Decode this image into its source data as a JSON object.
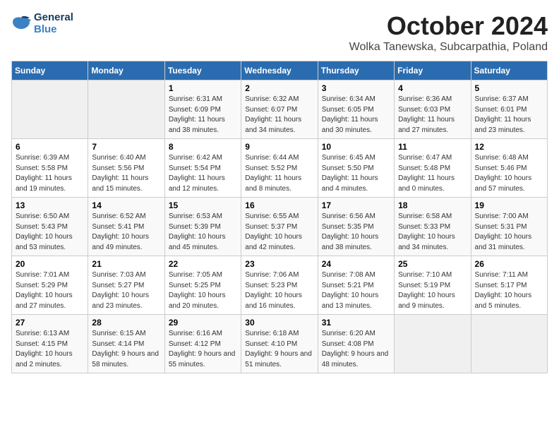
{
  "header": {
    "logo_line1": "General",
    "logo_line2": "Blue",
    "month_title": "October 2024",
    "subtitle": "Wolka Tanewska, Subcarpathia, Poland"
  },
  "weekdays": [
    "Sunday",
    "Monday",
    "Tuesday",
    "Wednesday",
    "Thursday",
    "Friday",
    "Saturday"
  ],
  "weeks": [
    [
      {
        "day": "",
        "info": ""
      },
      {
        "day": "",
        "info": ""
      },
      {
        "day": "1",
        "info": "Sunrise: 6:31 AM\nSunset: 6:09 PM\nDaylight: 11 hours and 38 minutes."
      },
      {
        "day": "2",
        "info": "Sunrise: 6:32 AM\nSunset: 6:07 PM\nDaylight: 11 hours and 34 minutes."
      },
      {
        "day": "3",
        "info": "Sunrise: 6:34 AM\nSunset: 6:05 PM\nDaylight: 11 hours and 30 minutes."
      },
      {
        "day": "4",
        "info": "Sunrise: 6:36 AM\nSunset: 6:03 PM\nDaylight: 11 hours and 27 minutes."
      },
      {
        "day": "5",
        "info": "Sunrise: 6:37 AM\nSunset: 6:01 PM\nDaylight: 11 hours and 23 minutes."
      }
    ],
    [
      {
        "day": "6",
        "info": "Sunrise: 6:39 AM\nSunset: 5:58 PM\nDaylight: 11 hours and 19 minutes."
      },
      {
        "day": "7",
        "info": "Sunrise: 6:40 AM\nSunset: 5:56 PM\nDaylight: 11 hours and 15 minutes."
      },
      {
        "day": "8",
        "info": "Sunrise: 6:42 AM\nSunset: 5:54 PM\nDaylight: 11 hours and 12 minutes."
      },
      {
        "day": "9",
        "info": "Sunrise: 6:44 AM\nSunset: 5:52 PM\nDaylight: 11 hours and 8 minutes."
      },
      {
        "day": "10",
        "info": "Sunrise: 6:45 AM\nSunset: 5:50 PM\nDaylight: 11 hours and 4 minutes."
      },
      {
        "day": "11",
        "info": "Sunrise: 6:47 AM\nSunset: 5:48 PM\nDaylight: 11 hours and 0 minutes."
      },
      {
        "day": "12",
        "info": "Sunrise: 6:48 AM\nSunset: 5:46 PM\nDaylight: 10 hours and 57 minutes."
      }
    ],
    [
      {
        "day": "13",
        "info": "Sunrise: 6:50 AM\nSunset: 5:43 PM\nDaylight: 10 hours and 53 minutes."
      },
      {
        "day": "14",
        "info": "Sunrise: 6:52 AM\nSunset: 5:41 PM\nDaylight: 10 hours and 49 minutes."
      },
      {
        "day": "15",
        "info": "Sunrise: 6:53 AM\nSunset: 5:39 PM\nDaylight: 10 hours and 45 minutes."
      },
      {
        "day": "16",
        "info": "Sunrise: 6:55 AM\nSunset: 5:37 PM\nDaylight: 10 hours and 42 minutes."
      },
      {
        "day": "17",
        "info": "Sunrise: 6:56 AM\nSunset: 5:35 PM\nDaylight: 10 hours and 38 minutes."
      },
      {
        "day": "18",
        "info": "Sunrise: 6:58 AM\nSunset: 5:33 PM\nDaylight: 10 hours and 34 minutes."
      },
      {
        "day": "19",
        "info": "Sunrise: 7:00 AM\nSunset: 5:31 PM\nDaylight: 10 hours and 31 minutes."
      }
    ],
    [
      {
        "day": "20",
        "info": "Sunrise: 7:01 AM\nSunset: 5:29 PM\nDaylight: 10 hours and 27 minutes."
      },
      {
        "day": "21",
        "info": "Sunrise: 7:03 AM\nSunset: 5:27 PM\nDaylight: 10 hours and 23 minutes."
      },
      {
        "day": "22",
        "info": "Sunrise: 7:05 AM\nSunset: 5:25 PM\nDaylight: 10 hours and 20 minutes."
      },
      {
        "day": "23",
        "info": "Sunrise: 7:06 AM\nSunset: 5:23 PM\nDaylight: 10 hours and 16 minutes."
      },
      {
        "day": "24",
        "info": "Sunrise: 7:08 AM\nSunset: 5:21 PM\nDaylight: 10 hours and 13 minutes."
      },
      {
        "day": "25",
        "info": "Sunrise: 7:10 AM\nSunset: 5:19 PM\nDaylight: 10 hours and 9 minutes."
      },
      {
        "day": "26",
        "info": "Sunrise: 7:11 AM\nSunset: 5:17 PM\nDaylight: 10 hours and 5 minutes."
      }
    ],
    [
      {
        "day": "27",
        "info": "Sunrise: 6:13 AM\nSunset: 4:15 PM\nDaylight: 10 hours and 2 minutes."
      },
      {
        "day": "28",
        "info": "Sunrise: 6:15 AM\nSunset: 4:14 PM\nDaylight: 9 hours and 58 minutes."
      },
      {
        "day": "29",
        "info": "Sunrise: 6:16 AM\nSunset: 4:12 PM\nDaylight: 9 hours and 55 minutes."
      },
      {
        "day": "30",
        "info": "Sunrise: 6:18 AM\nSunset: 4:10 PM\nDaylight: 9 hours and 51 minutes."
      },
      {
        "day": "31",
        "info": "Sunrise: 6:20 AM\nSunset: 4:08 PM\nDaylight: 9 hours and 48 minutes."
      },
      {
        "day": "",
        "info": ""
      },
      {
        "day": "",
        "info": ""
      }
    ]
  ]
}
